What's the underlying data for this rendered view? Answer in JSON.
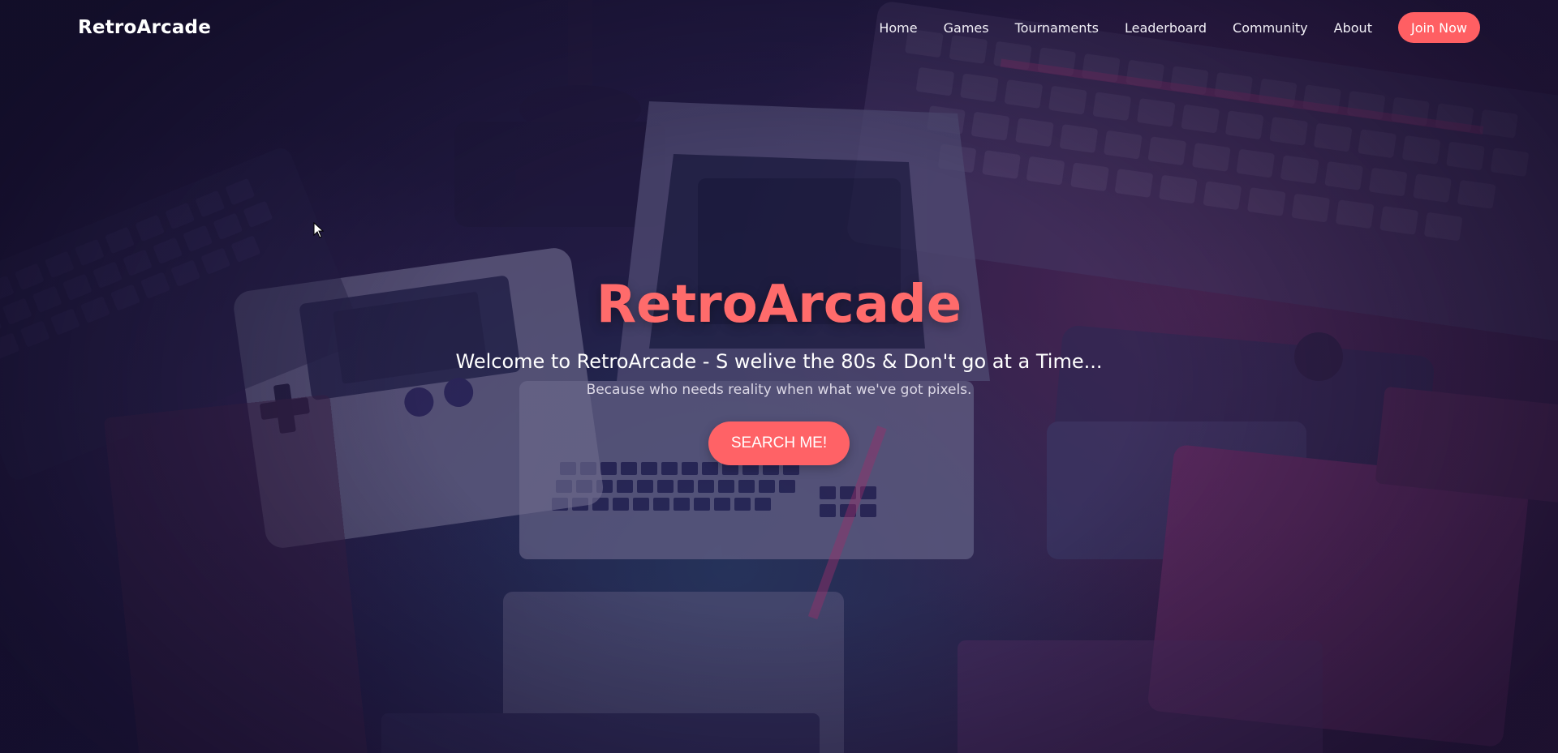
{
  "brand": {
    "logo_text": "RetroArcade"
  },
  "nav": {
    "items": [
      {
        "label": "Home"
      },
      {
        "label": "Games"
      },
      {
        "label": "Tournaments"
      },
      {
        "label": "Leaderboard"
      },
      {
        "label": "Community"
      },
      {
        "label": "About"
      }
    ],
    "cta_label": "Join Now"
  },
  "hero": {
    "title": "RetroArcade",
    "subtitle": "Welcome to RetroArcade - S welive the 80s & Don't go at a Time...",
    "tagline": "Because who needs reality when what we've got pixels.",
    "button_label": "SEARCH ME!"
  },
  "colors": {
    "accent": "#ff6266",
    "title": "#ff6b6b",
    "background_dark": "#1a1533",
    "text": "#ffffff"
  },
  "icons": {
    "cursor": "mouse-pointer-icon"
  }
}
